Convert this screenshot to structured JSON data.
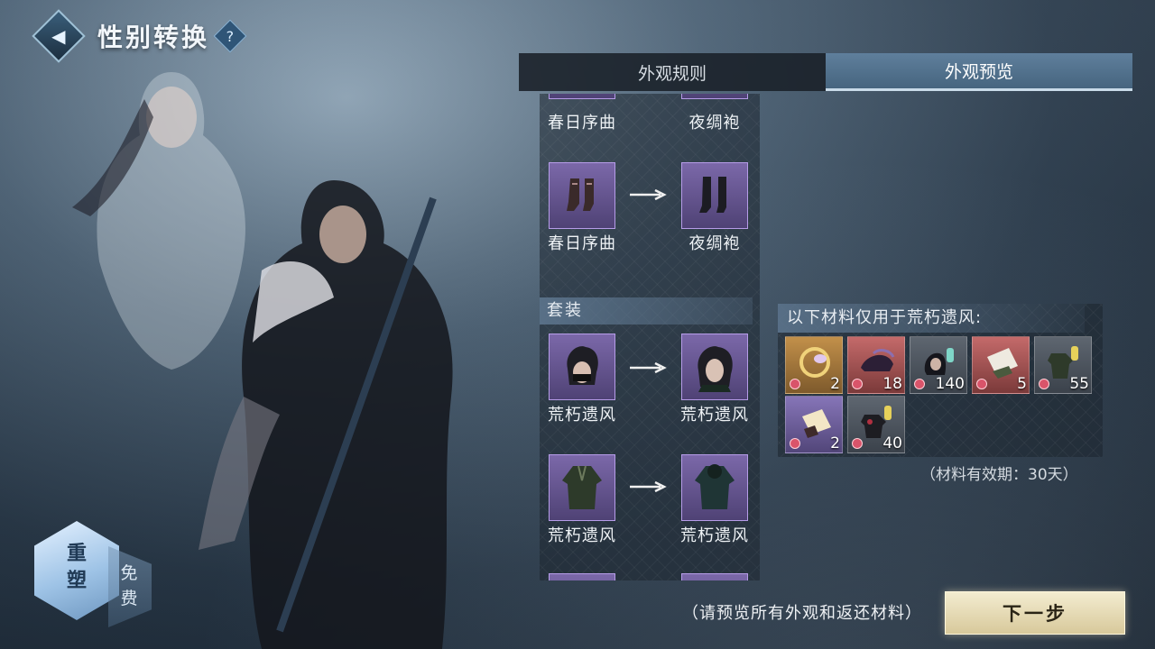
{
  "header": {
    "title": "性别转换",
    "help": "?"
  },
  "tabs": [
    {
      "label": "外观规则"
    },
    {
      "label": "外观预览"
    }
  ],
  "list": {
    "top_row": {
      "from": "春日序曲",
      "to": "夜绸袍"
    },
    "row_shoes": {
      "from": "春日序曲",
      "to": "夜绸袍"
    },
    "section_title": "套装",
    "row_hair": {
      "from": "荒朽遗风",
      "to": "荒朽遗风"
    },
    "row_outfit": {
      "from": "荒朽遗风",
      "to": "荒朽遗风"
    }
  },
  "materials": {
    "title": "以下材料仅用于荒朽遗风:",
    "items": [
      {
        "icon": "jade-ring-icon",
        "count": "2",
        "quality": "gold"
      },
      {
        "icon": "hat-icon",
        "count": "18",
        "quality": "red"
      },
      {
        "icon": "hair-dye-icon",
        "count": "140",
        "quality": "gray"
      },
      {
        "icon": "scroll-icon",
        "count": "5",
        "quality": "red"
      },
      {
        "icon": "outfit-dye-icon",
        "count": "55",
        "quality": "gray"
      },
      {
        "icon": "paper-icon",
        "count": "2",
        "quality": "purple"
      },
      {
        "icon": "armor-dye-icon",
        "count": "40",
        "quality": "gray"
      }
    ],
    "validity": "（材料有效期：30天）"
  },
  "footer": {
    "hint": "（请预览所有外观和返还材料）",
    "next_label": "下一步"
  },
  "reshape": {
    "label": "重塑",
    "free": "免费"
  },
  "colors": {
    "accent": "#46657f",
    "button": "#e8ddb5",
    "item_purple": "#7b68a9"
  }
}
